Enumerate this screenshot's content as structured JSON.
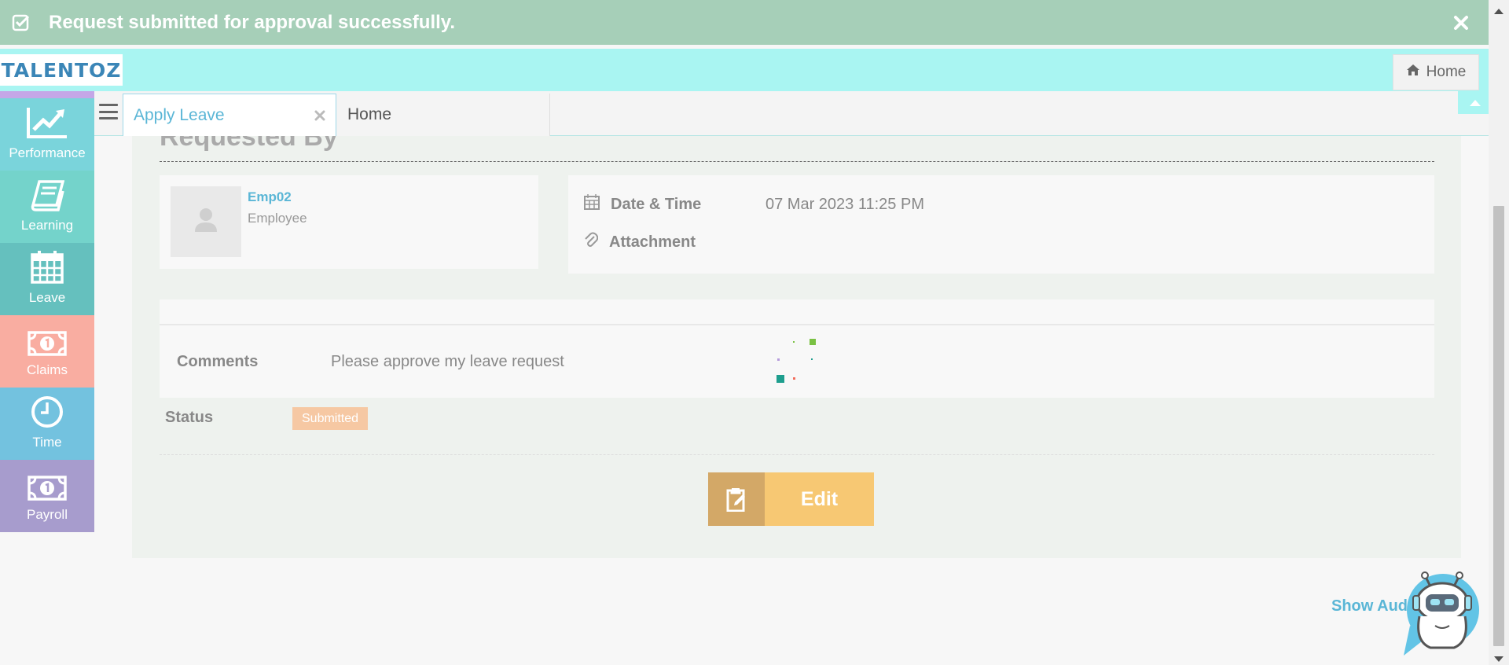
{
  "notification": {
    "message": "Request submitted for approval successfully.",
    "icon": "check-square-icon",
    "close_icon": "close-icon"
  },
  "header": {
    "logo_text": "TALENTOZ",
    "home_button_label": "Home"
  },
  "sidebar": {
    "items": [
      {
        "label": "Performance",
        "icon": "chart-line-icon",
        "color": "#7ad4db"
      },
      {
        "label": "Learning",
        "icon": "book-icon",
        "color": "#74d3cb"
      },
      {
        "label": "Leave",
        "icon": "calendar-icon",
        "color": "#65c0be"
      },
      {
        "label": "Claims",
        "icon": "money-icon",
        "color": "#f9ada1"
      },
      {
        "label": "Time",
        "icon": "clock-icon",
        "color": "#73c2df"
      },
      {
        "label": "Payroll",
        "icon": "money-icon",
        "color": "#a79ccd"
      }
    ]
  },
  "tabs": {
    "active_label": "Apply Leave",
    "second_label": "Home"
  },
  "request": {
    "section_title": "Requested By",
    "employee_name": "Emp02",
    "employee_role": "Employee",
    "datetime_label": "Date & Time",
    "datetime_value": "07 Mar 2023 11:25 PM",
    "attachment_label": "Attachment",
    "comments_label": "Comments",
    "comments_value": "Please approve my leave request",
    "status_label": "Status",
    "status_value": "Submitted",
    "edit_button_label": "Edit"
  },
  "footer": {
    "audit_link_label": "Show Audit"
  },
  "colors": {
    "accent": "#5ab6d6",
    "notification_bg": "#a6cfb8",
    "header_bg": "#a9f5f2",
    "status_badge": "#f6c8a3",
    "edit_button": "#f7c873"
  }
}
